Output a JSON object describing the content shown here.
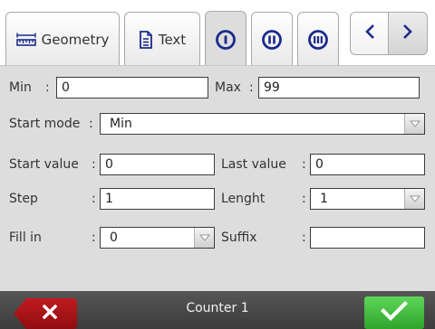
{
  "tabs": [
    {
      "label": "Geometry",
      "icon": "ruler-icon"
    },
    {
      "label": "Text",
      "icon": "text-document-icon"
    },
    {
      "label": "",
      "icon": "circle-one-icon",
      "active": true
    },
    {
      "label": "",
      "icon": "circle-two-icon"
    },
    {
      "label": "",
      "icon": "circle-three-icon"
    }
  ],
  "nav": {
    "prev_icon": "chevron-left-icon",
    "next_icon": "chevron-right-icon"
  },
  "form": {
    "min": {
      "label": "Min",
      "colon": ":",
      "value": "0"
    },
    "max": {
      "label": "Max",
      "colon": ":",
      "value": "99"
    },
    "start_mode": {
      "label": "Start mode",
      "colon": ":",
      "value": "Min"
    },
    "start_value": {
      "label": "Start value",
      "colon": ":",
      "value": "0"
    },
    "last_value": {
      "label": "Last value",
      "colon": ":",
      "value": "0"
    },
    "step": {
      "label": "Step",
      "colon": ":",
      "value": "1"
    },
    "length": {
      "label": "Lenght",
      "colon": ":",
      "value": "1"
    },
    "fill_in": {
      "label": "Fill in",
      "colon": ":",
      "value": "0"
    },
    "suffix": {
      "label": "Suffix",
      "colon": ":",
      "value": ""
    }
  },
  "bottom": {
    "title": "Counter 1",
    "cancel_icon": "close-icon",
    "ok_icon": "checkmark-icon"
  },
  "colors": {
    "panel": "#dddddd",
    "bar": "#4a4a4a",
    "cancel": "#b0161b",
    "ok": "#3fbf3a",
    "accent": "#1b2a8a"
  }
}
